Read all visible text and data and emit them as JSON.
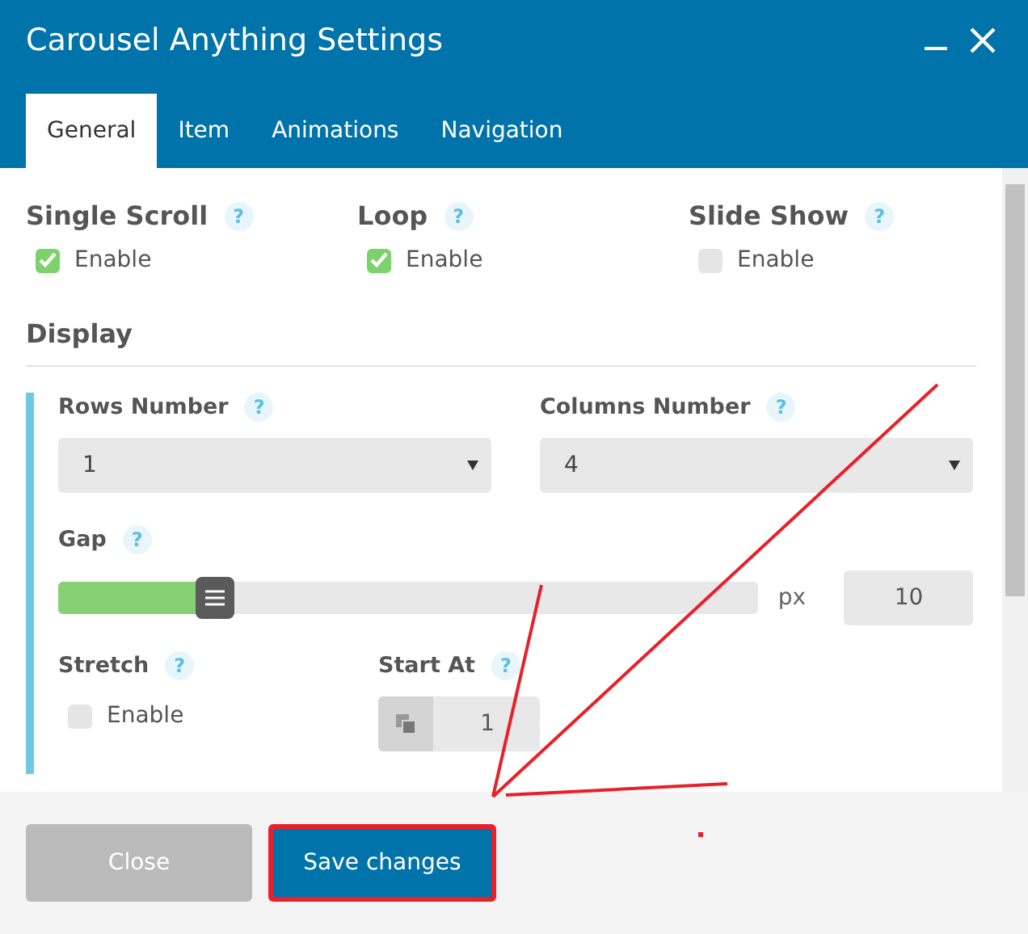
{
  "window": {
    "title": "Carousel Anything Settings"
  },
  "tabs": [
    {
      "label": "General",
      "selected": true
    },
    {
      "label": "Item",
      "selected": false
    },
    {
      "label": "Animations",
      "selected": false
    },
    {
      "label": "Navigation",
      "selected": false
    }
  ],
  "options": [
    {
      "label": "Single Scroll",
      "help": "?",
      "checkbox": "Enable",
      "checked": true
    },
    {
      "label": "Loop",
      "help": "?",
      "checkbox": "Enable",
      "checked": true
    },
    {
      "label": "Slide Show",
      "help": "?",
      "checkbox": "Enable",
      "checked": false
    }
  ],
  "display": {
    "heading": "Display",
    "rows_number": {
      "label": "Rows Number",
      "help": "?",
      "value": "1"
    },
    "columns_number": {
      "label": "Columns Number",
      "help": "?",
      "value": "4"
    },
    "gap": {
      "label": "Gap",
      "help": "?",
      "level": 0.22,
      "unit": "px",
      "value": "10"
    },
    "stretch": {
      "label": "Stretch",
      "help": "?",
      "checkbox": "Enable",
      "checked": false
    },
    "start_at": {
      "label": "Start At",
      "help": "?",
      "value": "1"
    }
  },
  "buttons": [
    {
      "label": "Close",
      "kind": "secondary",
      "highlighted": false
    },
    {
      "label": "Save changes",
      "kind": "primary",
      "highlighted": true
    }
  ]
}
